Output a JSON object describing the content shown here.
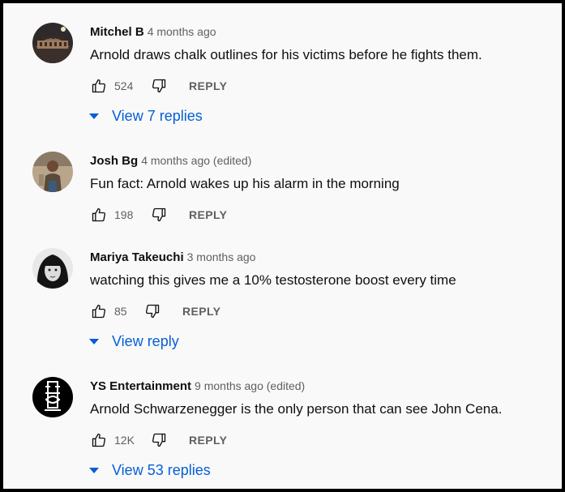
{
  "comments": [
    {
      "author": "Mitchel B",
      "time": "4 months ago",
      "text": "Arnold draws chalk outlines for his victims before he fights them.",
      "likes": "524",
      "reply_label": "REPLY",
      "replies_label": "View 7 replies",
      "avatar_icon": "colosseum-photo"
    },
    {
      "author": "Josh Bg",
      "time": "4 months ago (edited)",
      "text": "Fun fact: Arnold wakes up his alarm in the morning",
      "likes": "198",
      "reply_label": "REPLY",
      "avatar_icon": "person-photo"
    },
    {
      "author": "Mariya Takeuchi",
      "time": "3 months ago",
      "text": "watching this gives me a 10% testosterone boost every time",
      "likes": "85",
      "reply_label": "REPLY",
      "replies_label": "View reply",
      "avatar_icon": "portrait-photo"
    },
    {
      "author": "YS Entertainment",
      "time": "9 months ago (edited)",
      "text": "Arnold Schwarzenegger is the only person that can see John Cena.",
      "likes": "12K",
      "reply_label": "REPLY",
      "replies_label": "View 53 replies",
      "avatar_icon": "logo-monogram"
    }
  ],
  "colors": {
    "link": "#065fd4",
    "secondary_text": "#606060",
    "primary_text": "#0f0f0f",
    "frame": "#000000"
  }
}
